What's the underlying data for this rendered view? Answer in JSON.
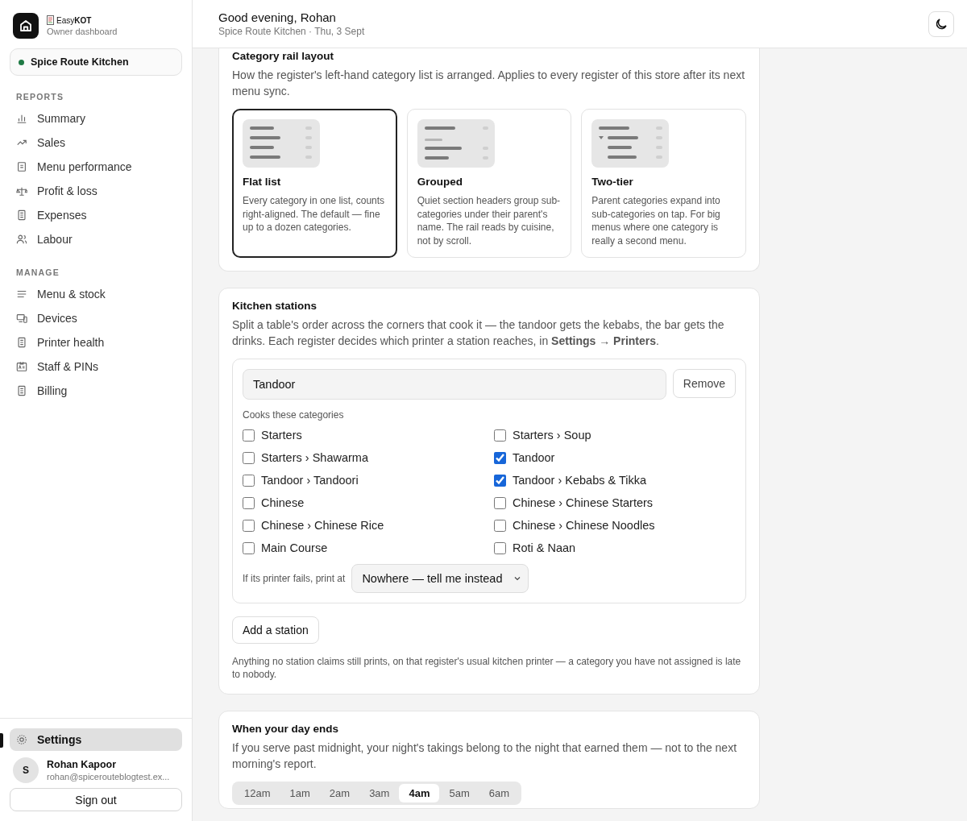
{
  "sidebar": {
    "brand": {
      "name": "Easy**KOT**",
      "subtitle": "Owner dashboard"
    },
    "store": {
      "name": "Spice Route Kitchen",
      "color": "#1f7a45"
    },
    "sections": [
      {
        "heading": "REPORTS",
        "items": [
          {
            "label": "Summary",
            "kind": "bars",
            "selected": false
          },
          {
            "label": "Sales",
            "kind": "trend",
            "selected": false
          },
          {
            "label": "Menu performance",
            "kind": "doc",
            "selected": false
          },
          {
            "label": "Profit & loss",
            "kind": "scale",
            "selected": false
          },
          {
            "label": "Expenses",
            "kind": "receipt",
            "selected": false
          },
          {
            "label": "Labour",
            "kind": "people",
            "selected": false
          }
        ]
      },
      {
        "heading": "MANAGE",
        "items": [
          {
            "label": "Menu & stock",
            "kind": "lines",
            "selected": false
          },
          {
            "label": "Devices",
            "kind": "devices",
            "selected": false
          },
          {
            "label": "Printer health",
            "kind": "receipt",
            "selected": false
          },
          {
            "label": "Staff & PINs",
            "kind": "badge",
            "selected": false
          },
          {
            "label": "Billing",
            "kind": "receipt",
            "selected": false
          }
        ]
      }
    ],
    "settings": {
      "label": "Settings",
      "selected": true
    },
    "user": {
      "initial": "S",
      "name": "Rohan Kapoor",
      "email": "rohan@spicerouteblogtest.ex..."
    },
    "sign_out": "Sign out"
  },
  "header": {
    "greeting": "Good evening, Rohan",
    "subtitle": "Spice Route Kitchen · Thu, 3 Sept"
  },
  "rail_layout": {
    "title": "Category rail layout",
    "description": "How the register's left-hand category list is arranged. Applies to every register of this store after its next menu sync.",
    "options": [
      {
        "kind": "flat",
        "title": "Flat list",
        "description": "Every category in one list, counts right-aligned. The default — fine up to a dozen categories.",
        "selected": true
      },
      {
        "kind": "grouped",
        "title": "Grouped",
        "description": "Quiet section headers group sub-categories under their parent's name. The rail reads by cuisine, not by scroll.",
        "selected": false
      },
      {
        "kind": "tiered",
        "title": "Two-tier",
        "description": "Parent categories expand into sub-categories on tap. For big menus where one category is really a second menu.",
        "selected": false
      }
    ]
  },
  "kitchen_stations": {
    "title": "Kitchen stations",
    "description": "Split a table's order across the corners that cook it — the tandoor gets the kebabs, the bar gets the drinks. Each register decides which printer a station reaches, in **Settings → Printers**.",
    "stations": [
      {
        "name": "Tandoor",
        "remove": "Remove",
        "categories_label": "Cooks these categories",
        "categories": [
          {
            "label": "Starters",
            "checked": false
          },
          {
            "label": "Starters › Soup",
            "checked": false
          },
          {
            "label": "Starters › Shawarma",
            "checked": false
          },
          {
            "label": "Tandoor",
            "checked": true
          },
          {
            "label": "Tandoor › Tandoori",
            "checked": false
          },
          {
            "label": "Tandoor › Kebabs & Tikka",
            "checked": true
          },
          {
            "label": "Chinese",
            "checked": false
          },
          {
            "label": "Chinese › Chinese Starters",
            "checked": false
          },
          {
            "label": "Chinese › Chinese Rice",
            "checked": false
          },
          {
            "label": "Chinese › Chinese Noodles",
            "checked": false
          },
          {
            "label": "Main Course",
            "checked": false
          },
          {
            "label": "Roti & Naan",
            "checked": false
          }
        ],
        "fallback_label": "If its printer fails, print at",
        "fallback_value": "Nowhere — tell me instead"
      }
    ],
    "add_button": "Add a station",
    "note": "Anything no station claims still prints, on that register's usual kitchen printer — a category you have not assigned is late to nobody."
  },
  "day_end": {
    "title": "When your day ends",
    "description": "If you serve past midnight, your night's takings belong to the night that earned them — not to the next morning's report.",
    "hours": [
      {
        "label": "12am",
        "selected": false
      },
      {
        "label": "1am",
        "selected": false
      },
      {
        "label": "2am",
        "selected": false
      },
      {
        "label": "3am",
        "selected": false
      },
      {
        "label": "4am",
        "selected": true
      },
      {
        "label": "5am",
        "selected": false
      },
      {
        "label": "6am",
        "selected": false
      }
    ]
  }
}
